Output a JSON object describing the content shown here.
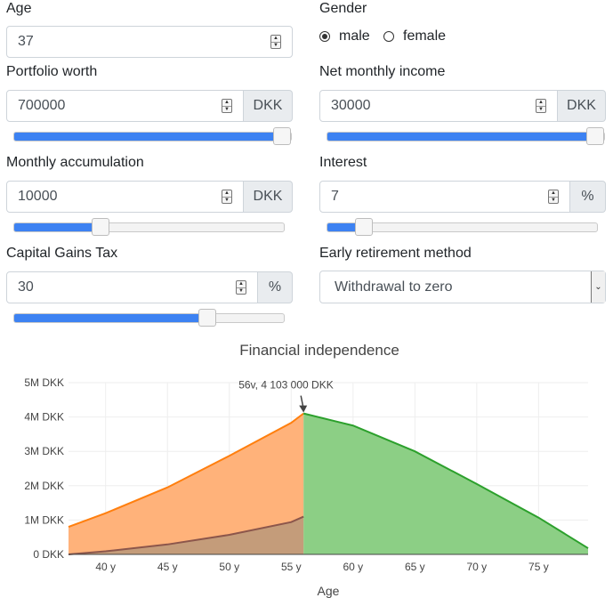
{
  "form": {
    "age": {
      "label": "Age",
      "value": "37"
    },
    "gender": {
      "label": "Gender",
      "options": [
        "male",
        "female"
      ],
      "selected": "male"
    },
    "portfolio": {
      "label": "Portfolio worth",
      "value": "700000",
      "unit": "DKK",
      "slider_fraction": 1.0
    },
    "income": {
      "label": "Net monthly income",
      "value": "30000",
      "unit": "DKK",
      "slider_fraction": 1.0
    },
    "accumulation": {
      "label": "Monthly accumulation",
      "value": "10000",
      "unit": "DKK",
      "slider_fraction": 0.33
    },
    "interest": {
      "label": "Interest",
      "value": "7",
      "unit": "%",
      "slider_fraction": 0.14
    },
    "tax": {
      "label": "Capital Gains Tax",
      "value": "30",
      "unit": "%",
      "slider_fraction": 0.74
    },
    "method": {
      "label": "Early retirement method",
      "value": "Withdrawal to zero"
    }
  },
  "chart_data": {
    "type": "area",
    "title": "Financial independence",
    "xlabel": "Age",
    "ylabel": "",
    "xlim": [
      37,
      79
    ],
    "ylim": [
      0,
      5000000
    ],
    "x_ticks": [
      40,
      45,
      50,
      55,
      60,
      65,
      70,
      75
    ],
    "x_tick_labels": [
      "40 y",
      "45 y",
      "50 y",
      "55 y",
      "60 y",
      "65 y",
      "70 y",
      "75 y"
    ],
    "y_ticks": [
      0,
      1000000,
      2000000,
      3000000,
      4000000,
      5000000
    ],
    "y_tick_labels": [
      "0 DKK",
      "1M DKK",
      "2M DKK",
      "3M DKK",
      "4M DKK",
      "5M DKK"
    ],
    "annotation": {
      "text": "56v,  4 103 000 DKK",
      "x": 56,
      "y": 4103000
    },
    "colors": {
      "accumulation": "#ff7f0e",
      "tax": "#8c564b",
      "withdrawal": "#2ca02c"
    },
    "series": [
      {
        "role": "accumulation",
        "x": [
          37,
          40,
          45,
          50,
          55,
          56
        ],
        "y": [
          800000,
          1200000,
          1950000,
          2870000,
          3830000,
          4103000
        ]
      },
      {
        "role": "tax",
        "x": [
          37,
          40,
          45,
          50,
          55,
          56
        ],
        "y": [
          0,
          90000,
          290000,
          570000,
          940000,
          1100000
        ]
      },
      {
        "role": "withdrawal",
        "x": [
          56,
          60,
          65,
          70,
          75,
          79
        ],
        "y": [
          4103000,
          3750000,
          3000000,
          2050000,
          1070000,
          180000
        ]
      }
    ]
  }
}
